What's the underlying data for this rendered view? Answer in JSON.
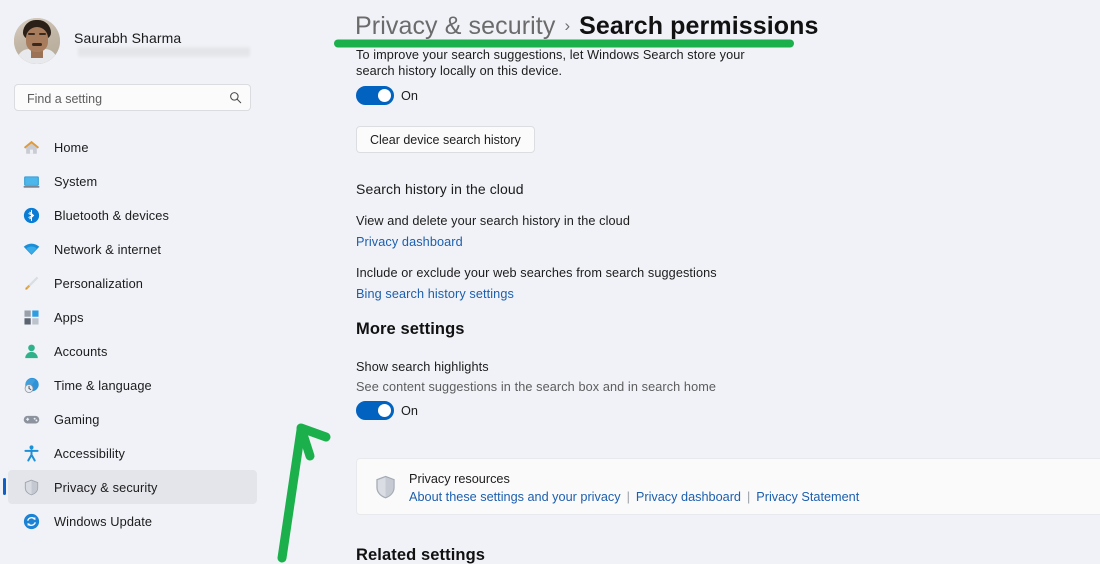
{
  "account": {
    "name": "Saurabh Sharma",
    "email_redacted": true,
    "avatar_icon": "user-avatar-photo"
  },
  "search": {
    "placeholder": "Find a setting",
    "value": "",
    "icon": "search-icon"
  },
  "sidebar": {
    "items": [
      {
        "label": "Home",
        "icon": "home-icon",
        "selected": false
      },
      {
        "label": "System",
        "icon": "system-monitor-icon",
        "selected": false
      },
      {
        "label": "Bluetooth & devices",
        "icon": "bluetooth-icon",
        "selected": false
      },
      {
        "label": "Network & internet",
        "icon": "wifi-icon",
        "selected": false
      },
      {
        "label": "Personalization",
        "icon": "paintbrush-icon",
        "selected": false
      },
      {
        "label": "Apps",
        "icon": "apps-grid-icon",
        "selected": false
      },
      {
        "label": "Accounts",
        "icon": "person-icon",
        "selected": false
      },
      {
        "label": "Time & language",
        "icon": "clock-globe-icon",
        "selected": false
      },
      {
        "label": "Gaming",
        "icon": "gamepad-icon",
        "selected": false
      },
      {
        "label": "Accessibility",
        "icon": "accessibility-person-icon",
        "selected": false
      },
      {
        "label": "Privacy & security",
        "icon": "shield-icon",
        "selected": true
      },
      {
        "label": "Windows Update",
        "icon": "update-refresh-icon",
        "selected": false
      }
    ]
  },
  "breadcrumb": {
    "parent": "Privacy & security",
    "separator": "›",
    "current": "Search permissions"
  },
  "main": {
    "device_history": {
      "description_line1": "To improve your search suggestions, let Windows Search store your",
      "description_line2": "search history locally on this device.",
      "toggle_state": "On",
      "clear_button": "Clear device search history"
    },
    "cloud_history": {
      "title": "Search history in the cloud",
      "row1_text": "View and delete your search history in the cloud",
      "row1_link": "Privacy dashboard",
      "row2_text": "Include or exclude your web searches from search suggestions",
      "row2_link": "Bing search history settings"
    },
    "more_settings": {
      "heading": "More settings",
      "highlight_title": "Show search highlights",
      "highlight_subtitle": "See content suggestions in the search box and in search home",
      "toggle_state": "On"
    },
    "privacy_card": {
      "icon": "shield-icon",
      "title": "Privacy resources",
      "links": [
        "About these settings and your privacy",
        "Privacy dashboard",
        "Privacy Statement"
      ],
      "separator": "|"
    },
    "related_settings_heading": "Related settings"
  },
  "annotations": {
    "color": "#1cb04c",
    "underline_target": "breadcrumb",
    "arrow_target": "show-search-highlights-toggle"
  }
}
